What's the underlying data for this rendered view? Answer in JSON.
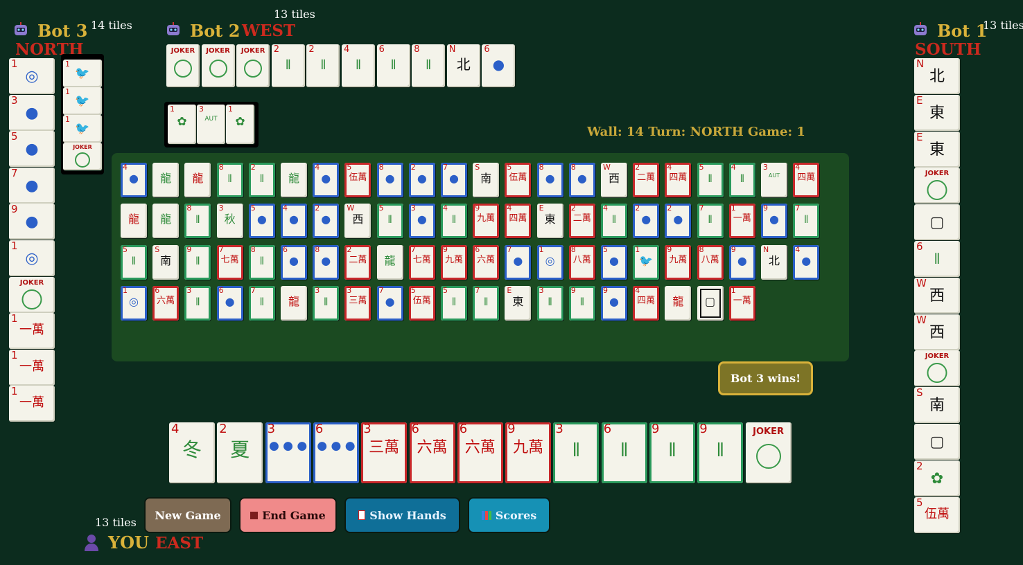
{
  "players": {
    "bot3": {
      "name": "Bot 3",
      "wind": "NORTH",
      "count": "14 tiles"
    },
    "bot2": {
      "name": "Bot 2",
      "wind": "WEST",
      "count": "13 tiles"
    },
    "bot1": {
      "name": "Bot 1",
      "wind": "SOUTH",
      "count": "13 tiles"
    },
    "you": {
      "name": "YOU",
      "wind": "EAST",
      "count": "13 tiles"
    }
  },
  "status": "Wall: 14 Turn: NORTH Game: 1",
  "winner": "Bot 3 wins!",
  "buttons": {
    "new_game": "New Game",
    "end_game": "End Game",
    "show_hands": "Show Hands",
    "scores": "Scores"
  },
  "colors": {
    "background": "#0c2c1e",
    "board": "#1b4a21",
    "gold": "#d9b23a",
    "wind_red": "#cc2a1e",
    "char_border": "#c8282a",
    "dot_border": "#2b5fc8",
    "bam_border": "#2a9a5c"
  },
  "hands": {
    "bot2": [
      {
        "n": "",
        "g": "JOKER",
        "c": "joker"
      },
      {
        "n": "",
        "g": "JOKER",
        "c": "joker"
      },
      {
        "n": "",
        "g": "JOKER",
        "c": "joker"
      },
      {
        "n": "2",
        "g": "𝍪",
        "c": "bam"
      },
      {
        "n": "2",
        "g": "𝍪",
        "c": "bam"
      },
      {
        "n": "4",
        "g": "𝍪",
        "c": "bam"
      },
      {
        "n": "6",
        "g": "𝍪",
        "c": "bam"
      },
      {
        "n": "8",
        "g": "𝍪",
        "c": "bam"
      },
      {
        "n": "N",
        "g": "北",
        "c": "wind"
      },
      {
        "n": "6",
        "g": "●",
        "c": "dot"
      }
    ],
    "bot2_exposed": [
      {
        "n": "1",
        "g": "✿",
        "c": "flower"
      },
      {
        "n": "3",
        "g": "AUT",
        "c": "flower"
      },
      {
        "n": "1",
        "g": "✿",
        "c": "flower"
      }
    ],
    "bot3": [
      {
        "n": "1",
        "g": "◎",
        "c": "dot"
      },
      {
        "n": "3",
        "g": "●",
        "c": "dot"
      },
      {
        "n": "5",
        "g": "●",
        "c": "dot"
      },
      {
        "n": "7",
        "g": "●",
        "c": "dot"
      },
      {
        "n": "9",
        "g": "●",
        "c": "dot"
      },
      {
        "n": "1",
        "g": "◎",
        "c": "dot"
      },
      {
        "n": "",
        "g": "JOKER",
        "c": "joker"
      },
      {
        "n": "1",
        "g": "一萬",
        "c": "char"
      },
      {
        "n": "1",
        "g": "一萬",
        "c": "char"
      },
      {
        "n": "1",
        "g": "一萬",
        "c": "char"
      }
    ],
    "bot3_exposed": [
      {
        "n": "1",
        "g": "🐦",
        "c": "bam"
      },
      {
        "n": "1",
        "g": "🐦",
        "c": "bam"
      },
      {
        "n": "1",
        "g": "🐦",
        "c": "bam"
      },
      {
        "n": "",
        "g": "JOKER",
        "c": "joker"
      }
    ],
    "bot1": [
      {
        "n": "N",
        "g": "北",
        "c": "wind"
      },
      {
        "n": "E",
        "g": "東",
        "c": "wind"
      },
      {
        "n": "E",
        "g": "東",
        "c": "wind"
      },
      {
        "n": "",
        "g": "JOKER",
        "c": "joker"
      },
      {
        "n": "",
        "g": "▢",
        "c": "dragon"
      },
      {
        "n": "6",
        "g": "𝍪",
        "c": "bam"
      },
      {
        "n": "W",
        "g": "西",
        "c": "wind"
      },
      {
        "n": "W",
        "g": "西",
        "c": "wind"
      },
      {
        "n": "",
        "g": "JOKER",
        "c": "joker"
      },
      {
        "n": "S",
        "g": "南",
        "c": "wind"
      },
      {
        "n": "",
        "g": "▢",
        "c": "dragon"
      },
      {
        "n": "2",
        "g": "✿",
        "c": "flower"
      },
      {
        "n": "5",
        "g": "伍萬",
        "c": "char"
      }
    ],
    "you": [
      {
        "n": "4",
        "g": "冬",
        "c": "flower"
      },
      {
        "n": "2",
        "g": "夏",
        "c": "flower"
      },
      {
        "n": "3",
        "g": "● ● ●",
        "c": "dot"
      },
      {
        "n": "6",
        "g": "● ● ●",
        "c": "dot"
      },
      {
        "n": "3",
        "g": "三萬",
        "c": "char"
      },
      {
        "n": "6",
        "g": "六萬",
        "c": "char"
      },
      {
        "n": "6",
        "g": "六萬",
        "c": "char"
      },
      {
        "n": "9",
        "g": "九萬",
        "c": "char"
      },
      {
        "n": "3",
        "g": "𝍪",
        "c": "bam"
      },
      {
        "n": "6",
        "g": "𝍪",
        "c": "bam"
      },
      {
        "n": "9",
        "g": "𝍪",
        "c": "bam"
      },
      {
        "n": "9",
        "g": "𝍪",
        "c": "bam"
      },
      {
        "n": "",
        "g": "JOKER",
        "c": "joker"
      }
    ]
  },
  "discards": [
    [
      {
        "n": "4",
        "g": "●",
        "c": "dot"
      },
      {
        "n": "",
        "g": "龍",
        "c": "greendragon"
      },
      {
        "n": "",
        "g": "龍",
        "c": "reddragon"
      },
      {
        "n": "8",
        "g": "𝍪",
        "c": "bam"
      },
      {
        "n": "2",
        "g": "𝍪",
        "c": "bam"
      },
      {
        "n": "",
        "g": "龍",
        "c": "greendragon"
      },
      {
        "n": "4",
        "g": "●",
        "c": "dot"
      },
      {
        "n": "5",
        "g": "伍萬",
        "c": "char"
      },
      {
        "n": "8",
        "g": "●",
        "c": "dot"
      },
      {
        "n": "2",
        "g": "●",
        "c": "dot"
      },
      {
        "n": "7",
        "g": "●",
        "c": "dot"
      },
      {
        "n": "S",
        "g": "南",
        "c": "wind"
      },
      {
        "n": "5",
        "g": "伍萬",
        "c": "char"
      },
      {
        "n": "8",
        "g": "●",
        "c": "dot"
      },
      {
        "n": "8",
        "g": "●",
        "c": "dot"
      },
      {
        "n": "W",
        "g": "西",
        "c": "wind"
      },
      {
        "n": "2",
        "g": "二萬",
        "c": "char"
      },
      {
        "n": "4",
        "g": "四萬",
        "c": "char"
      },
      {
        "n": "5",
        "g": "𝍪",
        "c": "bam"
      },
      {
        "n": "4",
        "g": "𝍪",
        "c": "bam"
      },
      {
        "n": "3",
        "g": "AUT",
        "c": "flower"
      },
      {
        "n": "4",
        "g": "四萬",
        "c": "char"
      }
    ],
    [
      {
        "n": "",
        "g": "龍",
        "c": "reddragon"
      },
      {
        "n": "",
        "g": "龍",
        "c": "greendragon"
      },
      {
        "n": "8",
        "g": "𝍪",
        "c": "bam"
      },
      {
        "n": "3",
        "g": "秋",
        "c": "flower"
      },
      {
        "n": "5",
        "g": "●",
        "c": "dot"
      },
      {
        "n": "4",
        "g": "●",
        "c": "dot"
      },
      {
        "n": "2",
        "g": "●",
        "c": "dot"
      },
      {
        "n": "W",
        "g": "西",
        "c": "wind"
      },
      {
        "n": "5",
        "g": "𝍪",
        "c": "bam"
      },
      {
        "n": "3",
        "g": "●",
        "c": "dot"
      },
      {
        "n": "4",
        "g": "𝍪",
        "c": "bam"
      },
      {
        "n": "9",
        "g": "九萬",
        "c": "char"
      },
      {
        "n": "4",
        "g": "四萬",
        "c": "char"
      },
      {
        "n": "E",
        "g": "東",
        "c": "wind"
      },
      {
        "n": "2",
        "g": "二萬",
        "c": "char"
      },
      {
        "n": "4",
        "g": "𝍪",
        "c": "bam"
      },
      {
        "n": "2",
        "g": "●",
        "c": "dot"
      },
      {
        "n": "2",
        "g": "●",
        "c": "dot"
      },
      {
        "n": "7",
        "g": "𝍪",
        "c": "bam"
      },
      {
        "n": "1",
        "g": "一萬",
        "c": "char"
      },
      {
        "n": "9",
        "g": "●",
        "c": "dot"
      },
      {
        "n": "7",
        "g": "𝍪",
        "c": "bam"
      }
    ],
    [
      {
        "n": "5",
        "g": "𝍪",
        "c": "bam"
      },
      {
        "n": "S",
        "g": "南",
        "c": "wind"
      },
      {
        "n": "9",
        "g": "𝍪",
        "c": "bam"
      },
      {
        "n": "7",
        "g": "七萬",
        "c": "char"
      },
      {
        "n": "8",
        "g": "𝍪",
        "c": "bam"
      },
      {
        "n": "6",
        "g": "●",
        "c": "dot"
      },
      {
        "n": "8",
        "g": "●",
        "c": "dot"
      },
      {
        "n": "2",
        "g": "二萬",
        "c": "char"
      },
      {
        "n": "",
        "g": "龍",
        "c": "greendragon"
      },
      {
        "n": "7",
        "g": "七萬",
        "c": "char"
      },
      {
        "n": "9",
        "g": "九萬",
        "c": "char"
      },
      {
        "n": "6",
        "g": "六萬",
        "c": "char"
      },
      {
        "n": "7",
        "g": "●",
        "c": "dot"
      },
      {
        "n": "1",
        "g": "◎",
        "c": "dot"
      },
      {
        "n": "8",
        "g": "八萬",
        "c": "char"
      },
      {
        "n": "5",
        "g": "●",
        "c": "dot"
      },
      {
        "n": "1",
        "g": "🐦",
        "c": "bam"
      },
      {
        "n": "9",
        "g": "九萬",
        "c": "char"
      },
      {
        "n": "8",
        "g": "八萬",
        "c": "char"
      },
      {
        "n": "9",
        "g": "●",
        "c": "dot"
      },
      {
        "n": "N",
        "g": "北",
        "c": "wind"
      },
      {
        "n": "4",
        "g": "●",
        "c": "dot"
      }
    ],
    [
      {
        "n": "1",
        "g": "◎",
        "c": "dot"
      },
      {
        "n": "6",
        "g": "六萬",
        "c": "char"
      },
      {
        "n": "3",
        "g": "𝍪",
        "c": "bam"
      },
      {
        "n": "6",
        "g": "●",
        "c": "dot"
      },
      {
        "n": "7",
        "g": "𝍪",
        "c": "bam"
      },
      {
        "n": "",
        "g": "龍",
        "c": "reddragon"
      },
      {
        "n": "3",
        "g": "𝍪",
        "c": "bam"
      },
      {
        "n": "3",
        "g": "三萬",
        "c": "char"
      },
      {
        "n": "7",
        "g": "●",
        "c": "dot"
      },
      {
        "n": "5",
        "g": "伍萬",
        "c": "char"
      },
      {
        "n": "5",
        "g": "𝍪",
        "c": "bam"
      },
      {
        "n": "7",
        "g": "𝍪",
        "c": "bam"
      },
      {
        "n": "E",
        "g": "東",
        "c": "wind"
      },
      {
        "n": "3",
        "g": "𝍪",
        "c": "bam"
      },
      {
        "n": "9",
        "g": "𝍪",
        "c": "bam"
      },
      {
        "n": "9",
        "g": "●",
        "c": "dot"
      },
      {
        "n": "4",
        "g": "四萬",
        "c": "char"
      },
      {
        "n": "",
        "g": "龍",
        "c": "reddragon"
      },
      {
        "n": "",
        "g": "▢",
        "c": "dragon"
      },
      {
        "n": "1",
        "g": "一萬",
        "c": "char"
      }
    ]
  ]
}
